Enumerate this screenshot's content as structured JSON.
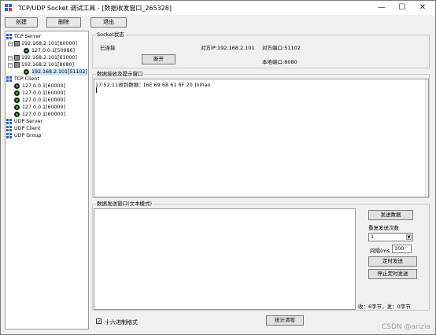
{
  "window": {
    "title": "TCP/UDP Socket 调试工具 - [数据收发窗口_265328]",
    "controls": {
      "minimize": "—",
      "maximize": "☐",
      "close": "✕"
    }
  },
  "toolbar": {
    "create": "创建",
    "delete": "删除",
    "exit": "退出"
  },
  "tree": {
    "tcp_server": "TCP Server",
    "server1": "192.168.2.101[60000]",
    "server1_conn": "127.0.0.1[50986]",
    "server2": "192.168.2.101[61000]",
    "server3": "192.168.2.101[8080]",
    "server3_conn": "192.168.2.101[51102]",
    "tcp_client": "TCP Client",
    "clients": [
      "127.0.0.1[60000]",
      "127.0.0.1[60000]",
      "127.0.0.1[60000]",
      "127.0.0.1[60000]",
      "127.0.0.1[60000]"
    ],
    "udp_server": "UDP Server",
    "udp_client": "UDP Client",
    "udp_group": "UDP Group"
  },
  "socket_status": {
    "legend": "Socket状态",
    "state": "已连接",
    "peer_ip": "对方IP:192.168.2.101",
    "peer_port": "对方端口:51102",
    "disconnect": "断开",
    "local_port": "本地端口:8080"
  },
  "receive": {
    "legend": "数据接收及提示窗口",
    "line1": "17:52:11收到数据：[6E 69 68 61 6F 20 ]nihao"
  },
  "send": {
    "legend": "数据发送窗口(文本模式)",
    "send_button": "发送数据",
    "repeat_label": "重复发送次数",
    "repeat_value": "1",
    "interval_label": "间隔(ms",
    "interval_value": "100",
    "timer_send": "定时发送",
    "stop_timer": "停止定时发送",
    "stats": "收：6字节，发：0字节"
  },
  "bottom": {
    "hex_label": "十六进制格式",
    "hex_checked": true,
    "clear_stats": "统计清零"
  },
  "watermark": "CSDN @arizia"
}
